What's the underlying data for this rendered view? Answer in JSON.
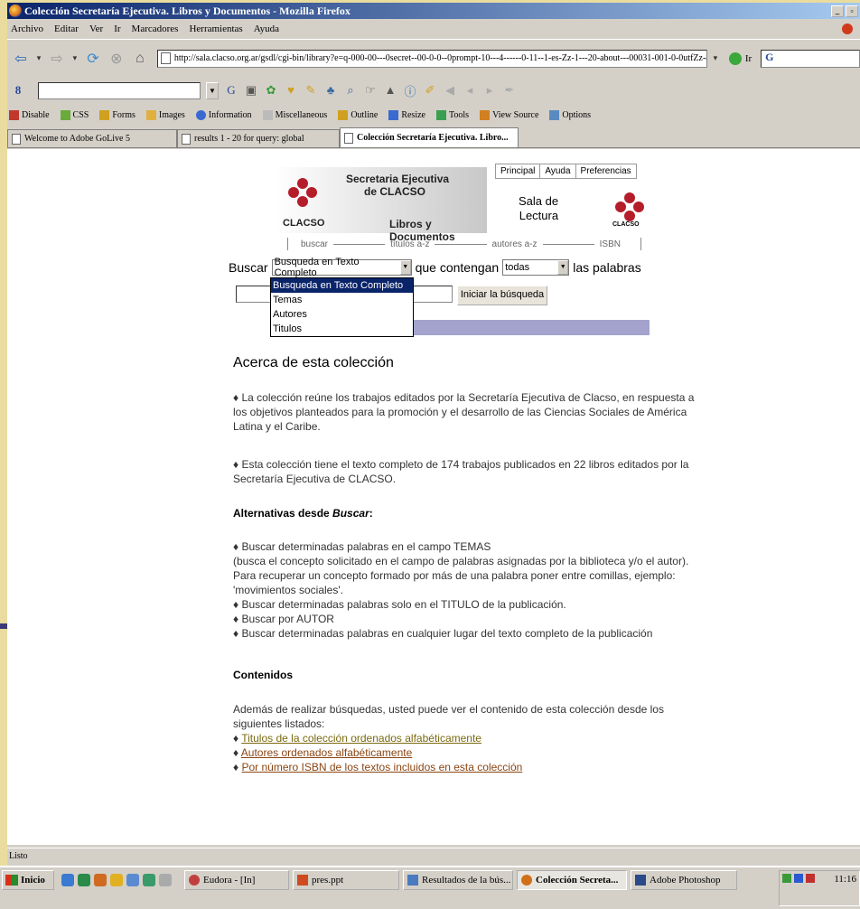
{
  "window": {
    "title": "Colección Secretaría Ejecutiva. Libros y Documentos - Mozilla Firefox"
  },
  "menu": [
    "Archivo",
    "Editar",
    "Ver",
    "Ir",
    "Marcadores",
    "Herramientas",
    "Ayuda"
  ],
  "navbar": {
    "url": "http://sala.clacso.org.ar/gsdl/cgi-bin/library?e=q-000-00---0secret--00-0-0--0prompt-10---4------0-11--1-es-Zz-1---20-about---00031-001-0-0utfZz-8-00&a=p&p",
    "go_label": "Ir",
    "search_engine_label": "G"
  },
  "webdev_toolbar": [
    "Disable",
    "CSS",
    "Forms",
    "Images",
    "Information",
    "Miscellaneous",
    "Outline",
    "Resize",
    "Tools",
    "View Source",
    "Options"
  ],
  "tabs": [
    {
      "label": "Welcome to Adobe GoLive 5"
    },
    {
      "label": "results 1 - 20 for query: global"
    },
    {
      "label": "Colección Secretaría Ejecutiva. Libro..."
    }
  ],
  "page": {
    "logo": {
      "org": "CLACSO",
      "line1": "Secretaria Ejecutiva",
      "line2": "de CLACSO",
      "line3": "Libros y Documentos",
      "right_logo": "CLACSO"
    },
    "top_links": [
      "Principal",
      "Ayuda",
      "Preferencias"
    ],
    "sala": {
      "line1": "Sala de",
      "line2": "Lectura"
    },
    "subnav": [
      "buscar",
      "títulos a-z",
      "autores a-z",
      "ISBN"
    ],
    "search": {
      "label_buscar": "Buscar",
      "selected_field": "Busqueda en Texto Completo",
      "label_contengan": "que contengan",
      "selected_mode": "todas",
      "label_palabras": "las palabras",
      "button": "Iniciar la búsqueda",
      "options": [
        "Busqueda en Texto Completo",
        "Temas",
        "Autores",
        "Titulos"
      ]
    },
    "about_title": "Acerca de esta colección",
    "about_p1": "♦ La colección reúne los trabajos editados por la Secretaría Ejecutiva de Clacso, en respuesta a los objetivos planteados para la promoción y el desarrollo de las Ciencias Sociales de América Latina y el Caribe.",
    "about_p2": "♦ Esta colección tiene el texto completo de 174 trabajos publicados en 22 libros editados por la Secretaría Ejecutiva de CLACSO.",
    "alt_title_prefix": "Alternativas desde ",
    "alt_title_em": "Buscar",
    "alt_title_suffix": ":",
    "alt_lines": [
      "♦ Buscar determinadas palabras en el campo TEMAS",
      "(busca el concepto solicitado en el campo de palabras asignadas por la biblioteca y/o el autor).",
      "Para recuperar un concepto formado por más de una palabra poner entre comillas, ejemplo:",
      "'movimientos sociales'.",
      "♦ Buscar determinadas palabras solo en el TITULO de la publicación.",
      "♦ Buscar por AUTOR",
      "♦ Buscar determinadas palabras en cualquier lugar del texto completo de la publicación"
    ],
    "contents_title": "Contenidos",
    "contents_intro": "Además de realizar búsquedas, usted puede ver el contenido de esta colección desde los siguientes listados:",
    "contents_links": [
      "Titulos de la colección ordenados alfabéticamente",
      "Autores ordenados alfabéticamente",
      "Por número ISBN de los textos incluidos en esta colección"
    ],
    "bullet": "♦"
  },
  "status": "Listo",
  "taskbar": {
    "start": "Inicio",
    "items": [
      "Eudora - [In]",
      "pres.ppt",
      "Resultados de la bús...",
      "Colección Secreta...",
      "Adobe Photoshop"
    ],
    "clock": "11:16"
  }
}
